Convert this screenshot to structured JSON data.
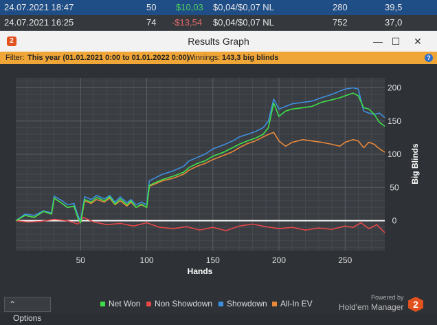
{
  "background_rows": [
    {
      "date": "24.07.2021 18:47",
      "hands": "50",
      "won": "$10,03",
      "stakes": "$0,04/$0,07 NL",
      "col5": "280",
      "col6": "39,5"
    },
    {
      "date": "24.07.2021 16:25",
      "hands": "74",
      "won": "-$13,54",
      "stakes": "$0,04/$0,07 NL",
      "col5": "752",
      "col6": "37,0"
    }
  ],
  "window": {
    "title": "Results Graph",
    "app_icon": "2",
    "controls": {
      "minimize": "—",
      "maximize": "☐",
      "close": "✕"
    }
  },
  "filter": {
    "label": "Filter:",
    "value": "This year (01.01.2021 0:00 to 01.01.2022 0:00)",
    "winnings_label": "Winnings:",
    "winnings_value": "143,3 big blinds",
    "help": "?"
  },
  "bottom": {
    "options_label": "Options",
    "options_icon": "chevron-up-icon",
    "powered_by": "Powered by",
    "brand": "Hold'em Manager",
    "brand_logo": "2"
  },
  "colors": {
    "net_won": "#3ee04a",
    "non_showdown": "#e64848",
    "showdown": "#3d8fe0",
    "allin_ev": "#e8883a"
  },
  "chart_data": {
    "type": "line",
    "xlabel": "Hands",
    "ylabel": "Big Blinds",
    "xlim": [
      1,
      280
    ],
    "ylim": [
      -45,
      215
    ],
    "xticks": [
      50,
      100,
      150,
      200,
      250
    ],
    "yticks": [
      0,
      50,
      100,
      150,
      200
    ],
    "grid": true,
    "legend": "bottom",
    "series": [
      {
        "name": "Net Won",
        "x": [
          1,
          8,
          15,
          22,
          28,
          30,
          36,
          40,
          45,
          48,
          50,
          53,
          58,
          62,
          68,
          72,
          76,
          80,
          85,
          88,
          92,
          96,
          100,
          102,
          106,
          112,
          120,
          128,
          132,
          138,
          144,
          150,
          158,
          165,
          170,
          176,
          182,
          188,
          192,
          196,
          200,
          205,
          210,
          218,
          225,
          232,
          240,
          246,
          250,
          256,
          260,
          264,
          268,
          272,
          276,
          280
        ],
        "values": [
          0,
          8,
          5,
          14,
          10,
          34,
          26,
          20,
          22,
          4,
          -3,
          32,
          28,
          35,
          30,
          36,
          25,
          33,
          24,
          30,
          20,
          25,
          20,
          53,
          57,
          62,
          67,
          73,
          80,
          86,
          90,
          97,
          103,
          110,
          115,
          120,
          124,
          130,
          140,
          177,
          157,
          165,
          168,
          170,
          172,
          178,
          182,
          185,
          188,
          192,
          188,
          170,
          168,
          160,
          148,
          142
        ]
      },
      {
        "name": "Non Showdown",
        "x": [
          1,
          10,
          20,
          30,
          40,
          48,
          52,
          60,
          70,
          80,
          90,
          100,
          110,
          120,
          130,
          140,
          150,
          160,
          170,
          180,
          190,
          200,
          210,
          220,
          230,
          240,
          250,
          256,
          262,
          268,
          274,
          280
        ],
        "values": [
          0,
          -2,
          -1,
          2,
          0,
          -5,
          5,
          -2,
          -6,
          -4,
          -8,
          -3,
          -10,
          -12,
          -9,
          -14,
          -10,
          -15,
          -8,
          -5,
          -9,
          -12,
          -10,
          -14,
          -11,
          -13,
          -8,
          -10,
          -3,
          -12,
          -6,
          -18
        ]
      },
      {
        "name": "Showdown",
        "x": [
          1,
          8,
          15,
          22,
          28,
          30,
          36,
          40,
          45,
          48,
          50,
          53,
          58,
          62,
          68,
          72,
          76,
          80,
          85,
          88,
          92,
          96,
          100,
          102,
          106,
          112,
          120,
          128,
          132,
          138,
          144,
          150,
          158,
          165,
          170,
          176,
          182,
          188,
          192,
          196,
          200,
          205,
          210,
          218,
          225,
          232,
          240,
          246,
          250,
          256,
          260,
          264,
          268,
          272,
          276,
          280
        ],
        "values": [
          0,
          10,
          8,
          15,
          12,
          37,
          30,
          24,
          26,
          8,
          0,
          36,
          32,
          38,
          33,
          38,
          28,
          36,
          27,
          32,
          24,
          28,
          24,
          60,
          64,
          70,
          75,
          82,
          90,
          95,
          100,
          108,
          114,
          120,
          126,
          130,
          134,
          140,
          150,
          183,
          168,
          172,
          176,
          178,
          180,
          185,
          190,
          195,
          198,
          200,
          198,
          165,
          162,
          160,
          162,
          155
        ]
      },
      {
        "name": "All-In EV",
        "x": [
          1,
          8,
          15,
          22,
          28,
          30,
          36,
          40,
          45,
          48,
          50,
          53,
          58,
          62,
          68,
          72,
          76,
          80,
          85,
          88,
          92,
          96,
          100,
          102,
          106,
          112,
          120,
          128,
          132,
          138,
          144,
          150,
          158,
          165,
          170,
          176,
          182,
          188,
          192,
          196,
          200,
          205,
          210,
          218,
          225,
          232,
          240,
          246,
          250,
          256,
          260,
          264,
          268,
          272,
          276,
          280
        ],
        "values": [
          0,
          8,
          5,
          14,
          10,
          34,
          26,
          20,
          22,
          4,
          -3,
          30,
          26,
          32,
          28,
          34,
          24,
          30,
          22,
          28,
          20,
          24,
          20,
          52,
          55,
          60,
          64,
          70,
          76,
          82,
          86,
          92,
          98,
          104,
          110,
          116,
          120,
          126,
          130,
          133,
          120,
          112,
          118,
          122,
          120,
          118,
          115,
          112,
          118,
          122,
          120,
          110,
          118,
          115,
          108,
          103
        ]
      }
    ]
  }
}
